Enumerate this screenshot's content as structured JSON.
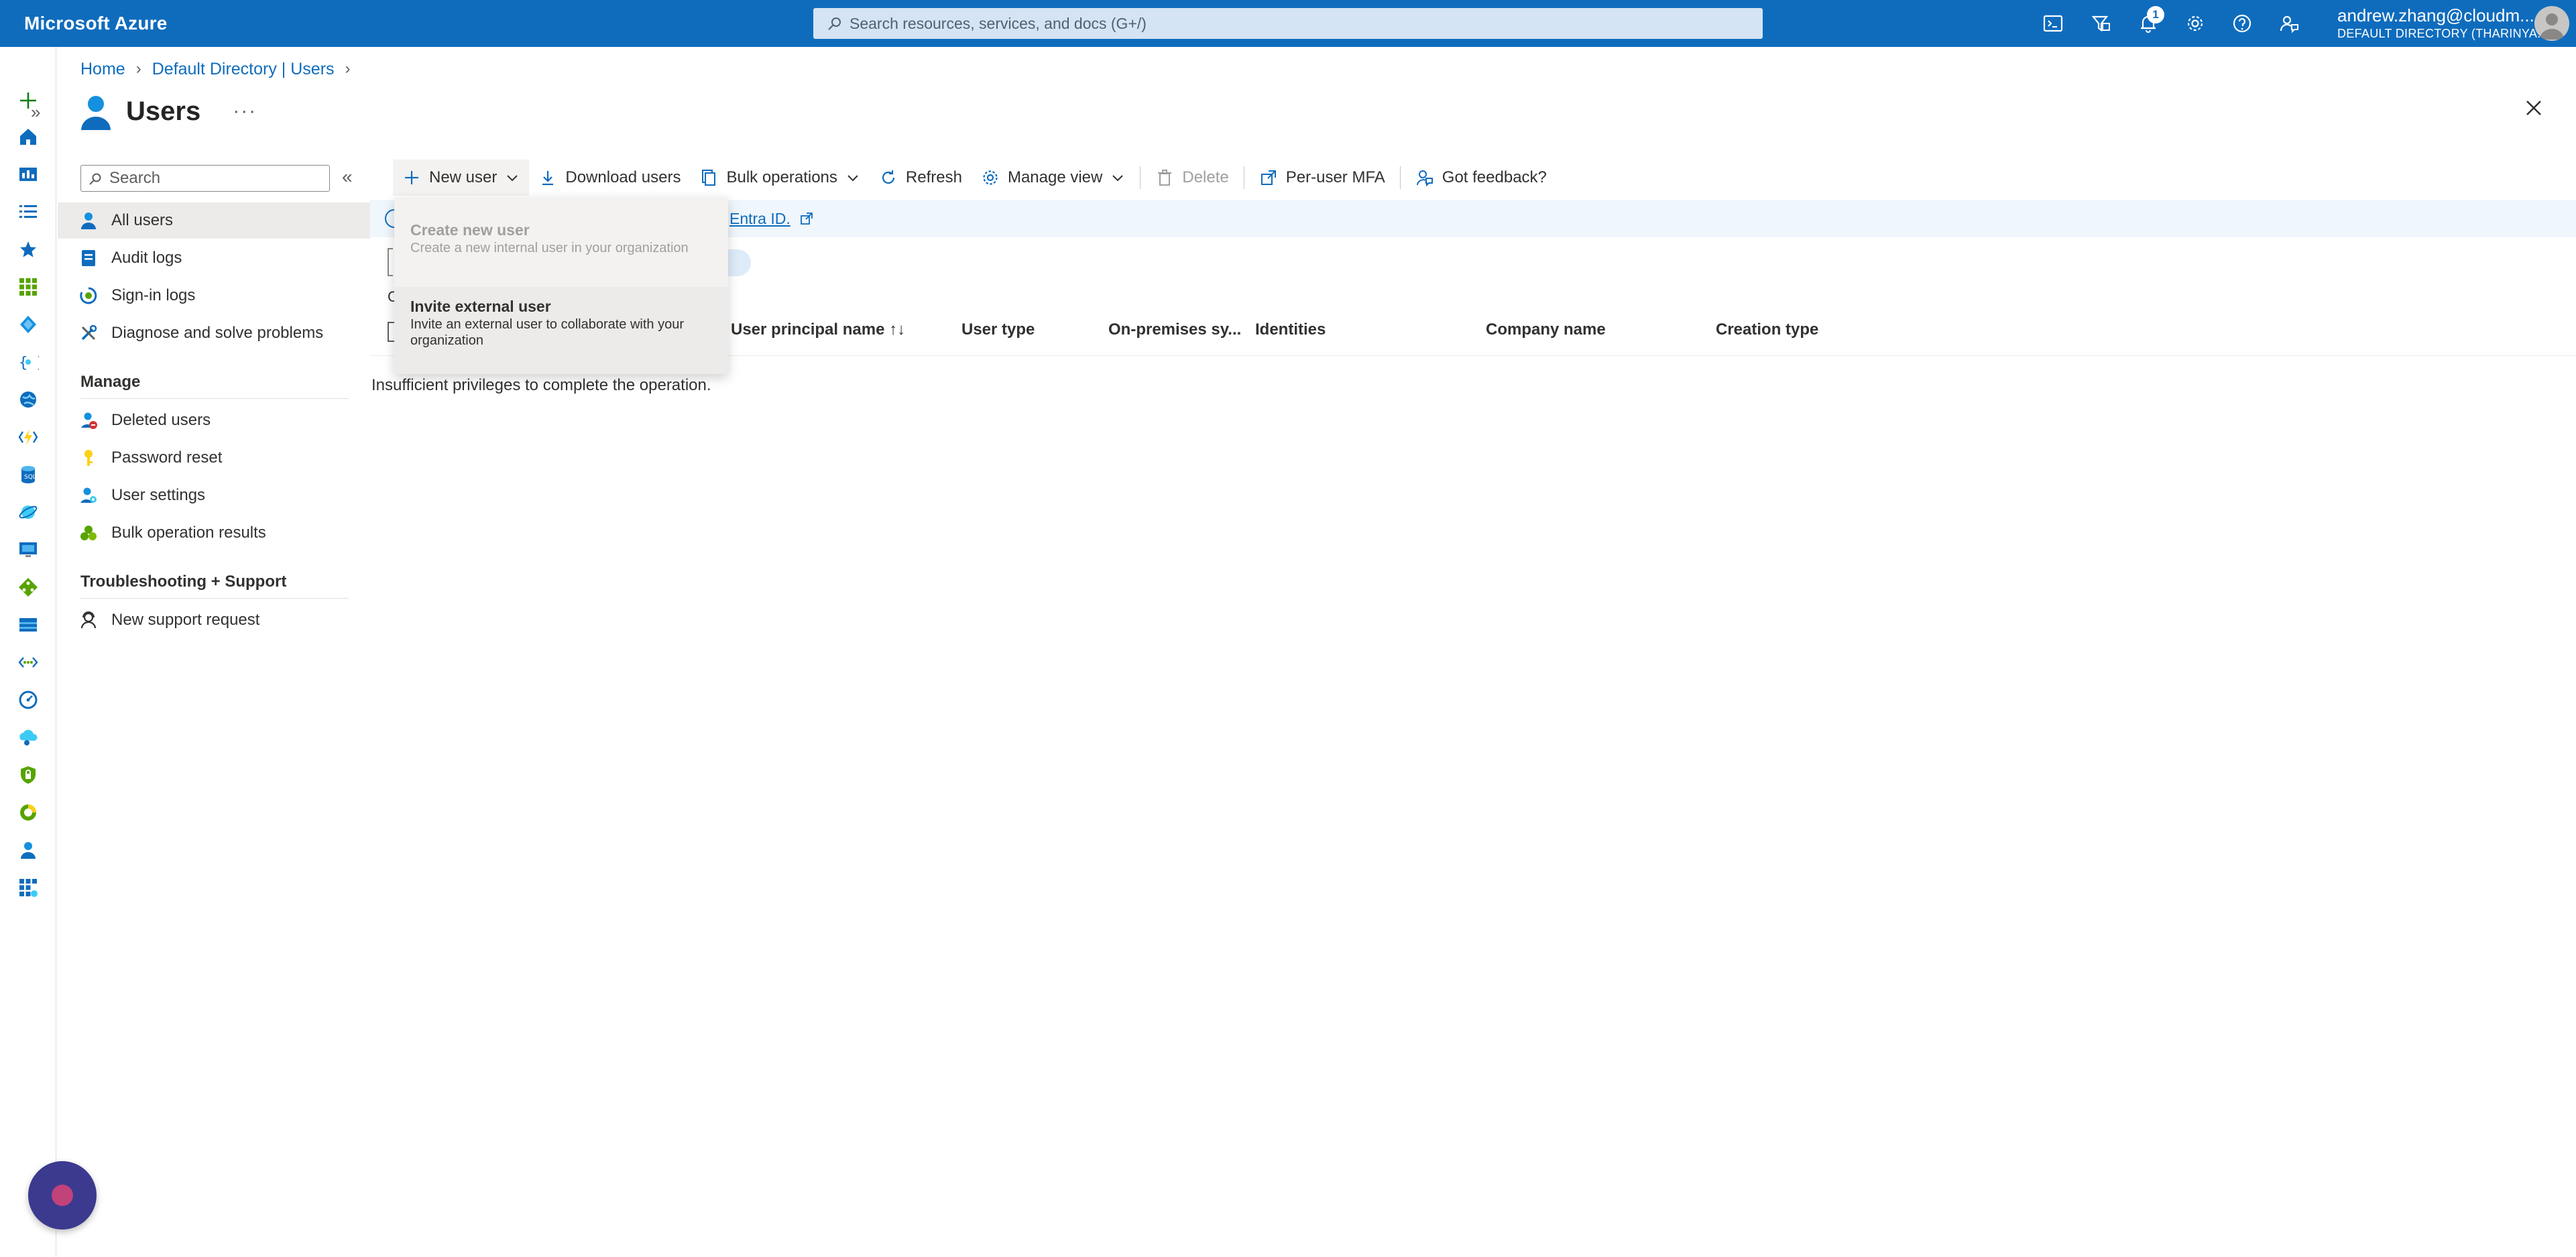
{
  "topbar": {
    "brand": "Microsoft Azure",
    "search_placeholder": "Search resources, services, and docs (G+/)",
    "notification_count": "1",
    "account_name": "andrew.zhang@cloudm...",
    "account_directory": "DEFAULT DIRECTORY (THARINYA...",
    "icons": [
      "cloud-shell-icon",
      "directory-filter-icon",
      "notifications-icon",
      "settings-icon",
      "help-icon",
      "feedback-icon"
    ]
  },
  "breadcrumb": {
    "items": [
      "Home",
      "Default Directory | Users"
    ]
  },
  "page": {
    "title": "Users",
    "more": "···"
  },
  "menu": {
    "search_placeholder": "Search",
    "items": [
      {
        "label": "All users",
        "icon": "user-icon",
        "selected": true
      },
      {
        "label": "Audit logs",
        "icon": "audit-log-icon"
      },
      {
        "label": "Sign-in logs",
        "icon": "sign-in-log-icon"
      },
      {
        "label": "Diagnose and solve problems",
        "icon": "wrench-icon"
      }
    ],
    "manage_section": "Manage",
    "manage_items": [
      {
        "label": "Deleted users",
        "icon": "deleted-user-icon"
      },
      {
        "label": "Password reset",
        "icon": "key-icon"
      },
      {
        "label": "User settings",
        "icon": "user-settings-icon"
      },
      {
        "label": "Bulk operation results",
        "icon": "bulk-results-icon"
      }
    ],
    "support_section": "Troubleshooting + Support",
    "support_items": [
      {
        "label": "New support request",
        "icon": "support-icon"
      }
    ]
  },
  "commandbar": {
    "new_user": "New user",
    "download_users": "Download users",
    "bulk_operations": "Bulk operations",
    "refresh": "Refresh",
    "manage_view": "Manage view",
    "delete": "Delete",
    "per_user_mfa": "Per-user MFA",
    "got_feedback": "Got feedback?"
  },
  "banner": {
    "link_text": "Entra ID."
  },
  "dropdown": {
    "create_title": "Create new user",
    "create_desc": "Create a new internal user in your organization",
    "invite_title": "Invite external user",
    "invite_desc_line1": "Invite an external user to collaborate with your",
    "invite_desc_line2": "organization"
  },
  "grid": {
    "columns": [
      "User principal name ↑↓",
      "User type",
      "On-premises sy...",
      "Identities",
      "Company name",
      "Creation type"
    ],
    "message": "Insufficient privileges to complete the operation.",
    "count_fragment": "C"
  },
  "colors": {
    "azure_blue": "#0f6cbd",
    "banner_bg": "#eff6fc",
    "selected_bg": "#ecebea"
  }
}
